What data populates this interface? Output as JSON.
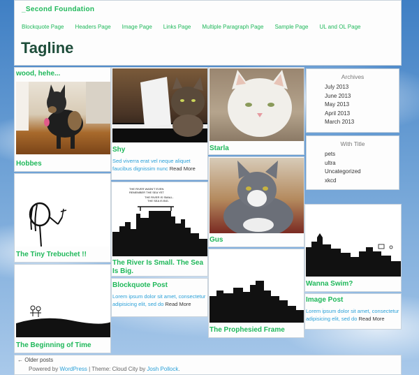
{
  "site": {
    "title": "_Second Foundation",
    "nav": [
      "Blockquote Page",
      "Headers Page",
      "Image Page",
      "Links Page",
      "Multiple Paragraph Page",
      "Sample Page",
      "UL and OL Page"
    ],
    "tagline": "Tagline"
  },
  "posts": {
    "wood": {
      "title": "wood, hehe..."
    },
    "hobbes": {
      "title": "Hobbes",
      "image_icon": "dog-photo"
    },
    "trebuchet": {
      "title": "The Tiny Trebuchet !!",
      "image_icon": "stick-figure-comic"
    },
    "beginning": {
      "title": "The Beginning of Time",
      "image_icon": "hill-comic"
    },
    "shy": {
      "title": "Shy",
      "excerpt": "Sed viverra erat vel neque aliquet faucibus dignissim nunc",
      "more": "Read More",
      "image_icon": "cat-piano-photo"
    },
    "river": {
      "title": "The River Is Small. The Sea Is Big.",
      "image_icon": "city-skyline-comic"
    },
    "blockquote": {
      "title": "Blockquote Post",
      "excerpt": "Lorem ipsum dolor sit amet, consectetur adipisicing elit, sed do",
      "more": "Read More"
    },
    "starla": {
      "title": "Starla",
      "image_icon": "white-cat-photo"
    },
    "gus": {
      "title": "Gus",
      "image_icon": "gray-cat-photo"
    },
    "prophesied": {
      "title": "The Prophesied Frame",
      "image_icon": "skyline-silhouette-comic"
    },
    "swim": {
      "title": "Wanna Swim?",
      "image_icon": "city-skyline-comic-2"
    },
    "imagepost": {
      "title": "Image Post",
      "excerpt": "Lorem ipsum dolor sit amet, consectetur adipisicing elit, sed do",
      "more": "Read More"
    }
  },
  "sidebar": {
    "archives": {
      "title": "Archives",
      "items": [
        "July 2013",
        "June 2013",
        "May 2013",
        "April 2013",
        "March 2013"
      ]
    },
    "with_title": {
      "title": "With Title",
      "items": [
        "pets",
        "ultra",
        "Uncategorized",
        "xkcd"
      ]
    }
  },
  "comic_text": {
    "river": [
      "THE RIVER WASN'T EVEN",
      "REMEMBER THE SEA YET",
      "THE RIVER IS SMALL.",
      "THE SEA IS BIG."
    ]
  },
  "footer": {
    "older": "← Older posts",
    "powered_prefix": "Powered by ",
    "wordpress": "WordPress",
    "sep": " | Theme: Cloud City by ",
    "author": "Josh Pollock",
    "end": "."
  },
  "colors": {
    "accent": "#1fb85a",
    "link": "#2aa0d8",
    "tagline": "#1e4d3a"
  }
}
